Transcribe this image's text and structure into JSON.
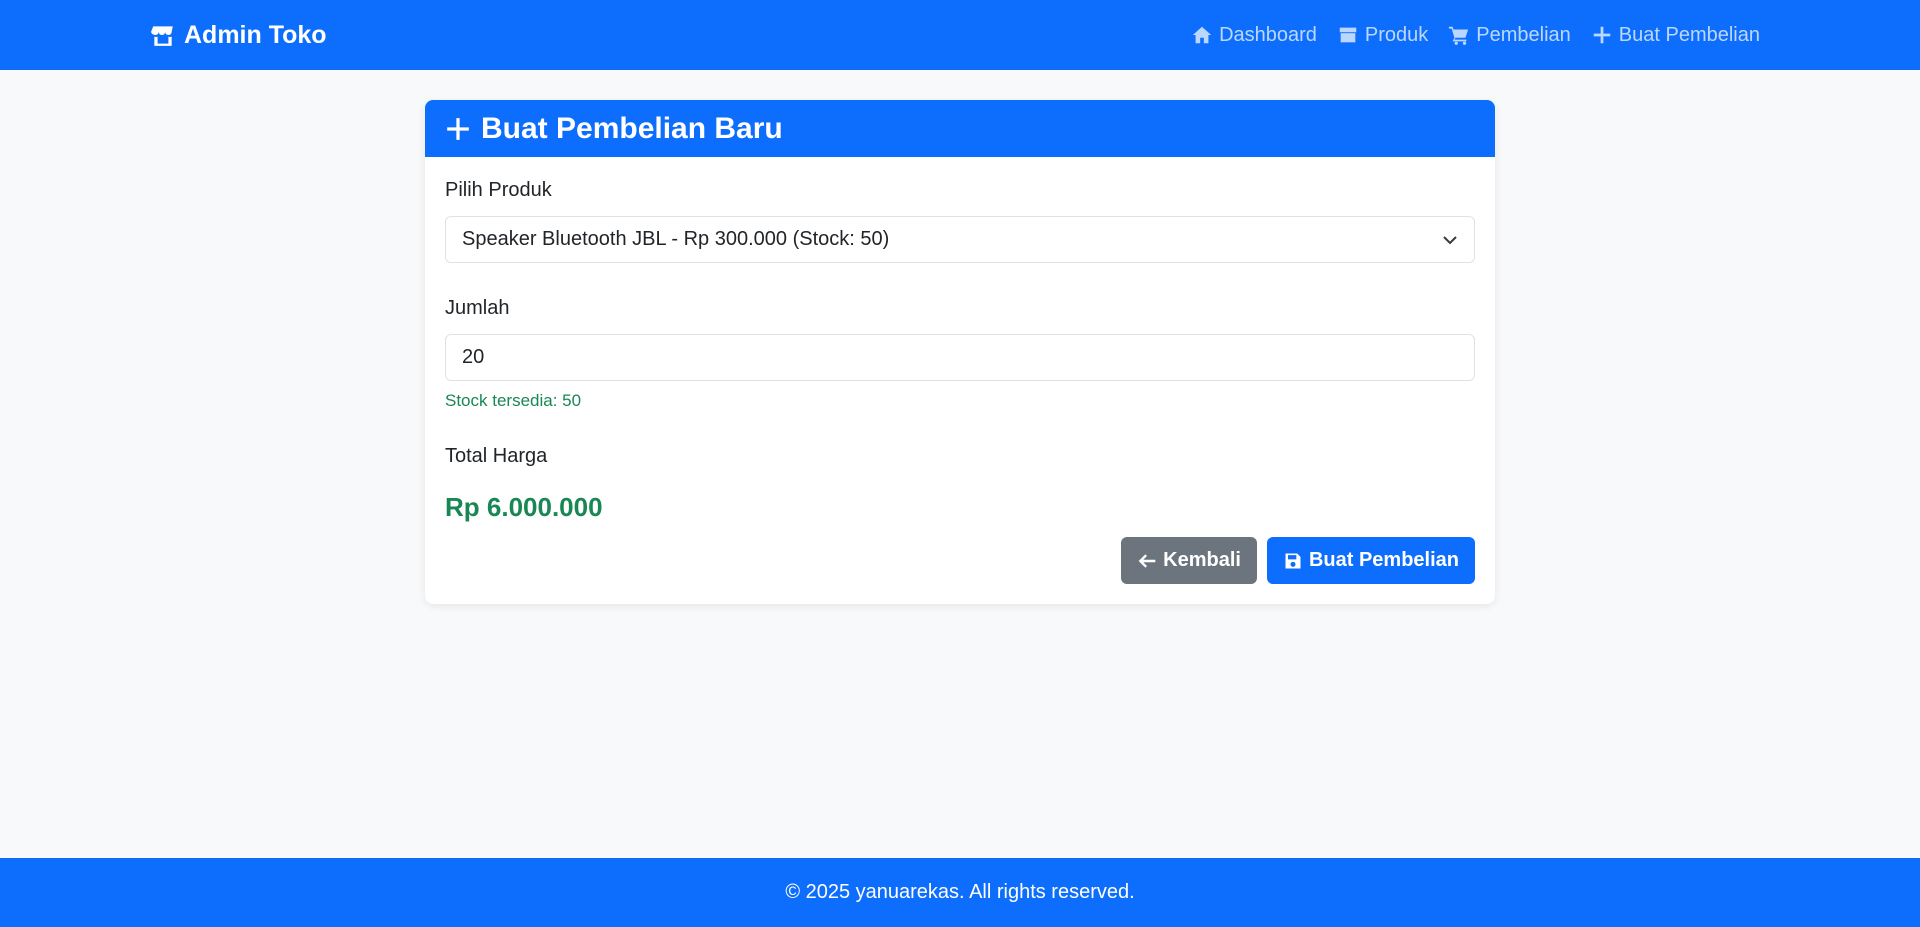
{
  "navbar": {
    "brand": "Admin Toko",
    "links": [
      {
        "label": "Dashboard",
        "icon": "home-icon"
      },
      {
        "label": "Produk",
        "icon": "box-icon"
      },
      {
        "label": "Pembelian",
        "icon": "cart-icon"
      },
      {
        "label": "Buat Pembelian",
        "icon": "plus-icon"
      }
    ]
  },
  "card": {
    "title": "Buat Pembelian Baru",
    "product_label": "Pilih Produk",
    "product_selected": "Speaker Bluetooth JBL - Rp 300.000 (Stock: 50)",
    "quantity_label": "Jumlah",
    "quantity_value": "20",
    "stock_hint": "Stock tersedia: 50",
    "total_label": "Total Harga",
    "total_value": "Rp 6.000.000",
    "back_button": "Kembali",
    "submit_button": "Buat Pembelian"
  },
  "footer": {
    "text": "© 2025 yanuarekas. All rights reserved."
  },
  "colors": {
    "primary": "#0d6efd",
    "secondary": "#6c757d",
    "success": "#198754",
    "background": "#f8f9fa"
  }
}
